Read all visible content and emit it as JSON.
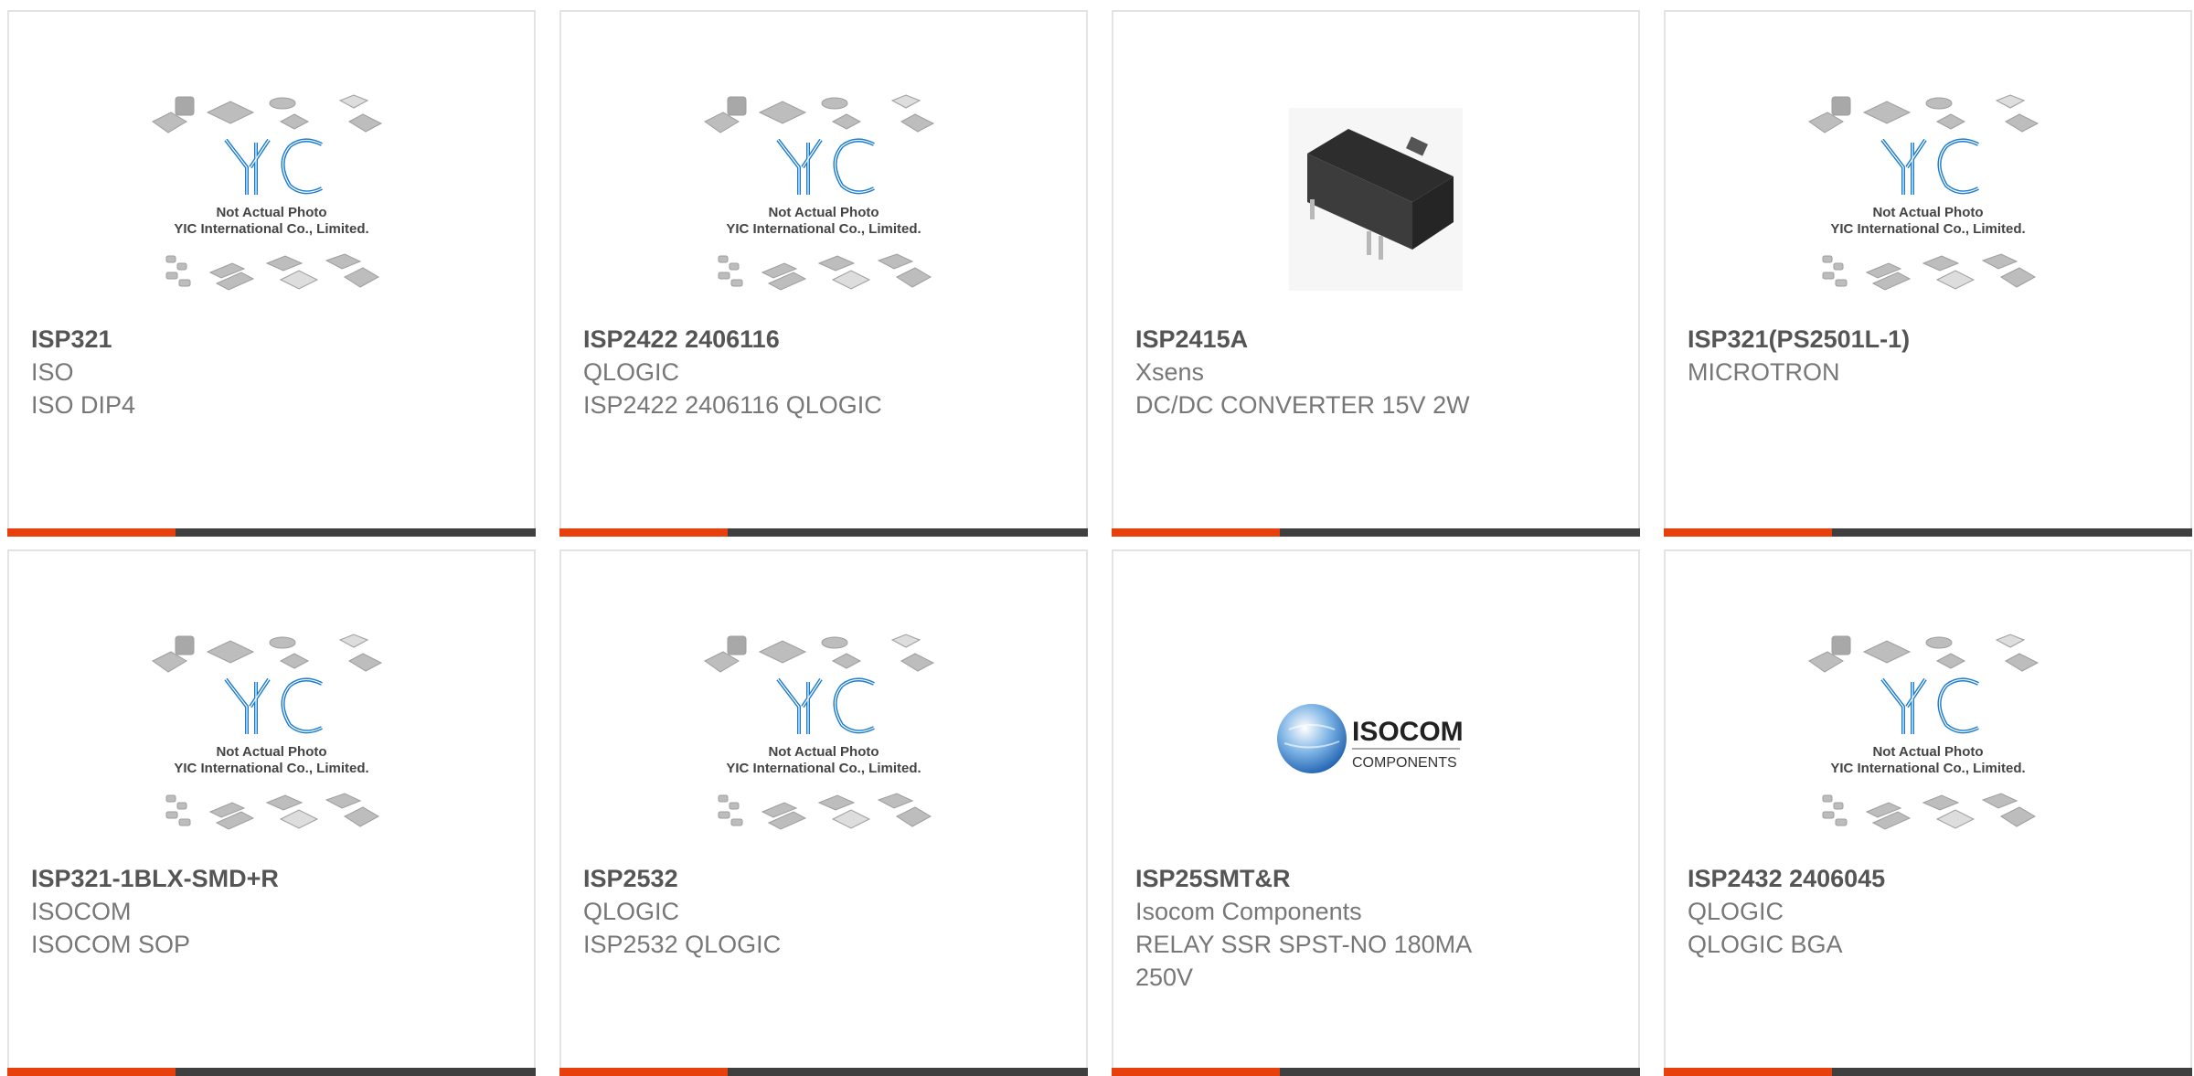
{
  "colors": {
    "accent": "#e8400c",
    "bar": "#3f3f3f",
    "logo_blue": "#1a7bd0"
  },
  "placeholder": {
    "line1": "Not Actual Photo",
    "line2": "YIC International Co., Limited."
  },
  "cards": [
    {
      "title": "ISP321",
      "maker": "ISO",
      "desc": "ISO DIP4",
      "image": "yic-placeholder"
    },
    {
      "title": "ISP2422 2406116",
      "maker": "QLOGIC",
      "desc": "ISP2422 2406116 QLOGIC",
      "image": "yic-placeholder"
    },
    {
      "title": "ISP2415A",
      "maker": "Xsens",
      "desc": "DC/DC CONVERTER 15V 2W",
      "image": "dc-converter-photo"
    },
    {
      "title": "ISP321(PS2501L-1)",
      "maker": "MICROTRON",
      "desc": "",
      "image": "yic-placeholder"
    },
    {
      "title": "ISP321-1BLX-SMD+R",
      "maker": "ISOCOM",
      "desc": "ISOCOM SOP",
      "image": "yic-placeholder"
    },
    {
      "title": "ISP2532",
      "maker": "QLOGIC",
      "desc": "ISP2532 QLOGIC",
      "image": "yic-placeholder"
    },
    {
      "title": "ISP25SMT&R",
      "maker": "Isocom Components",
      "desc": "RELAY SSR SPST-NO 180MA 250V",
      "image": "isocom-logo"
    },
    {
      "title": "ISP2432 2406045",
      "maker": "QLOGIC",
      "desc": "QLOGIC BGA",
      "image": "yic-placeholder"
    }
  ],
  "isocom_logo": {
    "line1": "ISOCOM",
    "line2": "COMPONENTS"
  }
}
